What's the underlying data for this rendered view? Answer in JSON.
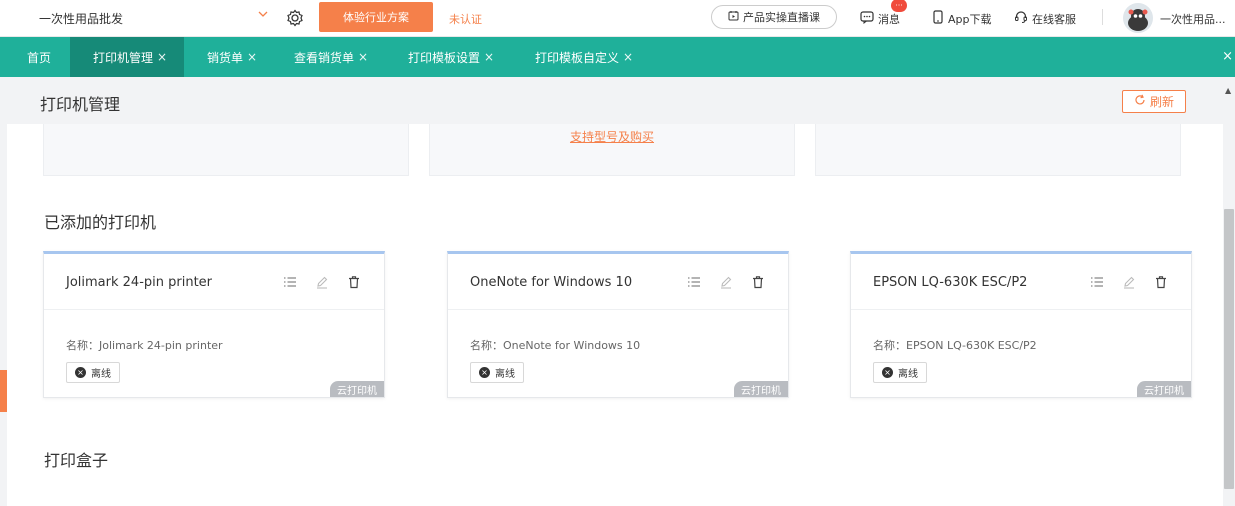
{
  "topbar": {
    "shop_select_value": "一次性用品批发",
    "experience_button": "体验行业方案",
    "unverified_label": "未认证",
    "live_course": "产品实操直播课",
    "messages": "消息",
    "message_badge": "···",
    "app_download": "App下载",
    "online_service": "在线客服",
    "user_name": "一次性用品..."
  },
  "tabs": {
    "home": "首页",
    "items": [
      {
        "label": "打印机管理",
        "close": "×"
      },
      {
        "label": "销货单",
        "close": "×"
      },
      {
        "label": "查看销货单",
        "close": "×"
      },
      {
        "label": "打印模板设置",
        "close": "×"
      },
      {
        "label": "打印模板自定义",
        "close": "×"
      }
    ],
    "close_all": "×"
  },
  "page": {
    "title": "打印机管理",
    "refresh_label": "刷新"
  },
  "support_link": "支持型号及购买",
  "sections": {
    "added_printers": "已添加的打印机",
    "print_box": "打印盒子"
  },
  "printers": [
    {
      "name": "Jolimark 24-pin printer",
      "label_prefix": "名称：",
      "label_value": "Jolimark 24-pin printer",
      "status": "离线",
      "tag": "云打印机"
    },
    {
      "name": "OneNote for Windows 10",
      "label_prefix": "名称：",
      "label_value": "OneNote for Windows 10",
      "status": "离线",
      "tag": "云打印机"
    },
    {
      "name": "EPSON LQ-630K ESC/P2",
      "label_prefix": "名称：",
      "label_value": "EPSON LQ-630K ESC/P2",
      "status": "离线",
      "tag": "云打印机"
    }
  ],
  "colors": {
    "brand_teal": "#1fb09a",
    "active_tab": "#168a78",
    "accent_orange": "#f5804a",
    "card_top_border": "#a7c6ef"
  }
}
